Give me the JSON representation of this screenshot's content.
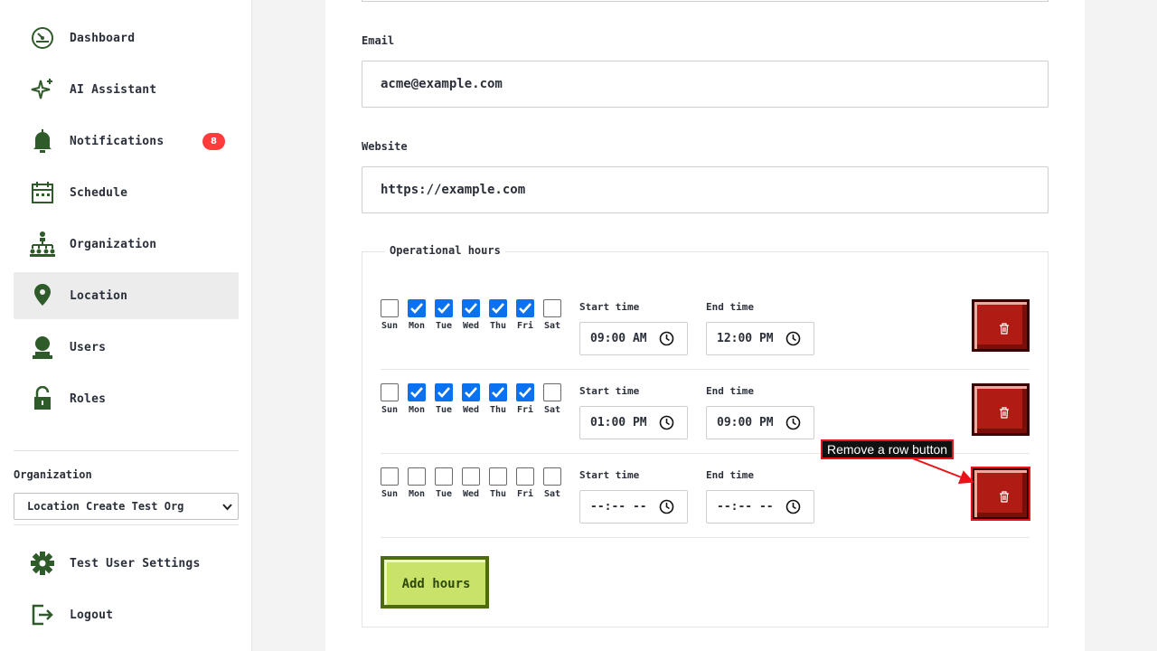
{
  "sidebar": {
    "items": [
      {
        "label": "Dashboard",
        "icon": "dashboard-icon"
      },
      {
        "label": "AI Assistant",
        "icon": "sparkle-icon"
      },
      {
        "label": "Notifications",
        "icon": "bell-icon",
        "badge": "8"
      },
      {
        "label": "Schedule",
        "icon": "calendar-icon"
      },
      {
        "label": "Organization",
        "icon": "org-chart-icon"
      },
      {
        "label": "Location",
        "icon": "map-pin-icon",
        "active": true
      },
      {
        "label": "Users",
        "icon": "user-icon"
      },
      {
        "label": "Roles",
        "icon": "lock-icon"
      }
    ],
    "organization_label": "Organization",
    "organization_selected": "Location Create Test Org",
    "settings_label": "Test User Settings",
    "logout_label": "Logout"
  },
  "form": {
    "email_label": "Email",
    "email_value": "acme@example.com",
    "website_label": "Website",
    "website_value": "https://example.com",
    "hours_legend": "Operational hours",
    "start_time_label": "Start time",
    "end_time_label": "End time",
    "days": [
      "Sun",
      "Mon",
      "Tue",
      "Wed",
      "Thu",
      "Fri",
      "Sat"
    ],
    "rows": [
      {
        "checked": [
          false,
          true,
          true,
          true,
          true,
          true,
          false
        ],
        "start": "09:00 AM",
        "end": "12:00 PM"
      },
      {
        "checked": [
          false,
          true,
          true,
          true,
          true,
          true,
          false
        ],
        "start": "01:00 PM",
        "end": "09:00 PM"
      },
      {
        "checked": [
          false,
          false,
          false,
          false,
          false,
          false,
          false
        ],
        "start": "--:-- --",
        "end": "--:-- --"
      }
    ],
    "add_hours_label": "Add hours"
  },
  "annotation": {
    "label": "Remove a row button"
  },
  "colors": {
    "checkbox_blue": "#0a72f0",
    "remove_red": "#b01c14",
    "add_green": "#c9e26a",
    "badge_red": "#ff3b3b",
    "sidebar_icon_green": "#2f5a2a"
  }
}
